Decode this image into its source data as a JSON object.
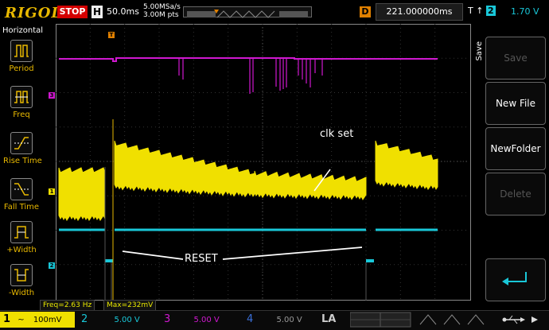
{
  "topbar": {
    "brand": "RIGOL",
    "run_state": "STOP",
    "horizontal_key": "H",
    "timebase": "50.0ms",
    "sample_rate": "5.00MSa/s",
    "memory_depth": "3.00M pts",
    "delay_key": "D",
    "delay_value": "221.000000ms",
    "trigger_key": "T",
    "trigger_source": "2",
    "trigger_level": "1.70 V"
  },
  "left_menu": {
    "title": "Horizontal",
    "items": [
      {
        "label": "Period",
        "icon": "period-icon"
      },
      {
        "label": "Freq",
        "icon": "freq-icon"
      },
      {
        "label": "Rise Time",
        "icon": "rise-time-icon"
      },
      {
        "label": "Fall Time",
        "icon": "fall-time-icon"
      },
      {
        "label": "+Width",
        "icon": "plus-width-icon"
      },
      {
        "label": "-Width",
        "icon": "minus-width-icon"
      }
    ]
  },
  "right_menu": {
    "title": "Save",
    "buttons": [
      {
        "label": "Save",
        "enabled": false
      },
      {
        "label": "New File",
        "enabled": true
      },
      {
        "label": "NewFolder",
        "enabled": true
      },
      {
        "label": "Delete",
        "enabled": false
      },
      {
        "label": "",
        "icon": "return-arrow-icon",
        "enabled": true
      }
    ]
  },
  "annotations": {
    "clk_set": "clk set",
    "reset": "RESET"
  },
  "channel_markers": {
    "ch1": "1",
    "ch2": "2",
    "ch3": "3",
    "trigger": "T"
  },
  "measurements": {
    "freq": "Freq=2.63 Hz",
    "max": "Max=232mV"
  },
  "channels": [
    {
      "num": "1",
      "coupling": "~",
      "scale": "100mV",
      "color": "#f0e000",
      "active": true
    },
    {
      "num": "2",
      "scale": "5.00 V",
      "color": "#19c7d8"
    },
    {
      "num": "3",
      "scale": "5.00 V",
      "color": "#d018d0"
    },
    {
      "num": "4",
      "scale": "5.00 V",
      "color": "#3a6fd8"
    }
  ],
  "la_label": "LA",
  "colors": {
    "ch1": "#f0e000",
    "ch2": "#19c7d8",
    "ch3": "#d018d0",
    "ch4": "#3a6fd8",
    "accent": "#e8b800"
  }
}
